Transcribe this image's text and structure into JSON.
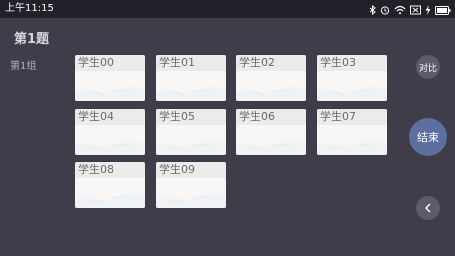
{
  "status_bar": {
    "time": "上午11:15",
    "icons": [
      "bluetooth-icon",
      "alarm-icon",
      "wifi-icon",
      "signal-blocked-icon",
      "flash-icon",
      "battery-icon"
    ]
  },
  "page": {
    "title": "第1题",
    "group_label": "第1组"
  },
  "students": [
    {
      "name": "学生00"
    },
    {
      "name": "学生01"
    },
    {
      "name": "学生02"
    },
    {
      "name": "学生03"
    },
    {
      "name": "学生04"
    },
    {
      "name": "学生05"
    },
    {
      "name": "学生06"
    },
    {
      "name": "学生07"
    },
    {
      "name": "学生08"
    },
    {
      "name": "学生09"
    }
  ],
  "actions": {
    "compare_label": "对比",
    "end_label": "结束",
    "back_icon": "chevron-left-icon"
  },
  "colors": {
    "background": "#3f3d4a",
    "status_bar": "#222129",
    "card": "#f9f6f6",
    "end_button": "#5c6f9f",
    "circle_button": "#5d5a6b"
  }
}
